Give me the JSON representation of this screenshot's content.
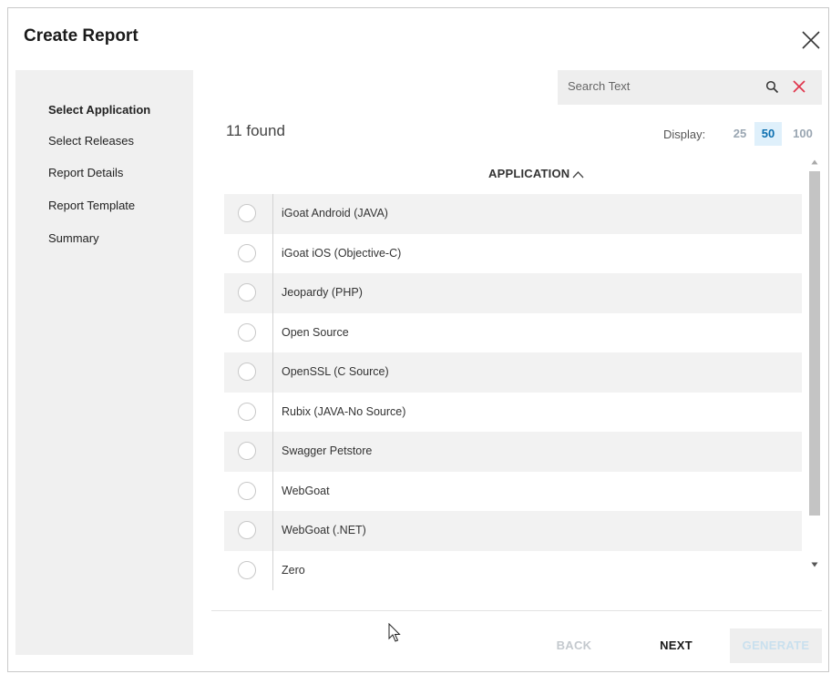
{
  "dialog": {
    "title": "Create Report"
  },
  "sidebar": {
    "steps": [
      {
        "label": "Select Application",
        "active": true
      },
      {
        "label": "Select Releases",
        "active": false
      },
      {
        "label": "Report Details",
        "active": false
      },
      {
        "label": "Report Template",
        "active": false
      },
      {
        "label": "Summary",
        "active": false
      }
    ]
  },
  "search": {
    "placeholder": "Search Text",
    "value": ""
  },
  "results": {
    "found_text": "11 found",
    "display_label": "Display:",
    "page_sizes": [
      "25",
      "50",
      "100"
    ],
    "selected_page_size": "50"
  },
  "table": {
    "column_header": "APPLICATION",
    "sort": "ascending",
    "rows": [
      "iGoat Android (JAVA)",
      "iGoat iOS (Objective-C)",
      "Jeopardy (PHP)",
      "Open Source",
      "OpenSSL (C Source)",
      "Rubix (JAVA-No Source)",
      "Swagger Petstore",
      "WebGoat",
      "WebGoat (.NET)",
      "Zero"
    ]
  },
  "footer": {
    "back_label": "BACK",
    "next_label": "NEXT",
    "generate_label": "GENERATE"
  },
  "colors": {
    "accent": "#0b6fb0",
    "active_page_bg": "#dff0fb",
    "clear_icon": "#e0344b",
    "sidebar_bg": "#f0f0f0",
    "row_alt_bg": "#f2f2f2"
  },
  "icons": {
    "close": "close-icon",
    "search": "search-icon",
    "clear": "clear-icon",
    "sort": "chevron-up-icon",
    "radio": "radio-icon"
  }
}
